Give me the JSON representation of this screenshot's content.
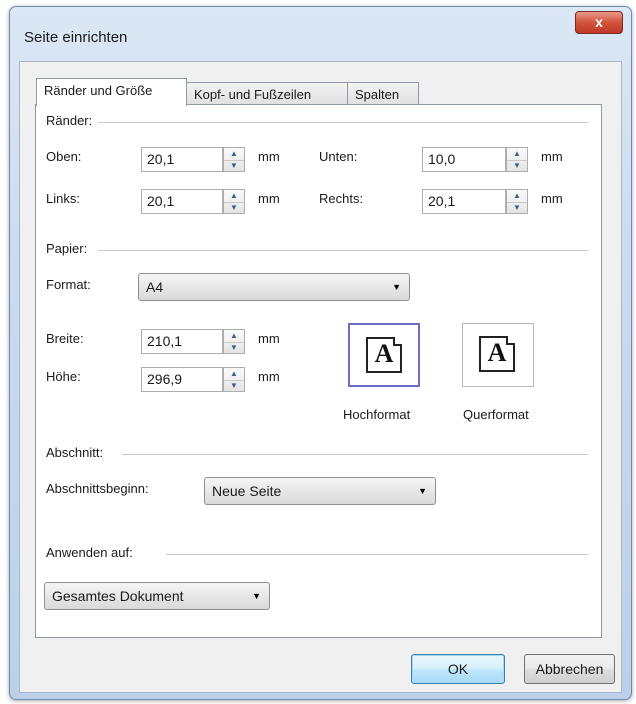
{
  "window": {
    "title": "Seite einrichten",
    "close_label": "x"
  },
  "tabs": [
    {
      "label": "Ränder und Größe",
      "active": true
    },
    {
      "label": "Kopf- und Fußzeilen",
      "active": false
    },
    {
      "label": "Spalten",
      "active": false
    }
  ],
  "margins": {
    "group_label": "Ränder:",
    "top": {
      "label": "Oben:",
      "value": "20,1",
      "unit": "mm"
    },
    "bottom": {
      "label": "Unten:",
      "value": "10,0",
      "unit": "mm"
    },
    "left": {
      "label": "Links:",
      "value": "20,1",
      "unit": "mm"
    },
    "right": {
      "label": "Rechts:",
      "value": "20,1",
      "unit": "mm"
    }
  },
  "paper": {
    "group_label": "Papier:",
    "format_label": "Format:",
    "format_value": "A4",
    "width": {
      "label": "Breite:",
      "value": "210,1",
      "unit": "mm"
    },
    "height": {
      "label": "Höhe:",
      "value": "296,9",
      "unit": "mm"
    },
    "orientation": {
      "portrait_label": "Hochformat",
      "landscape_label": "Querformat",
      "glyph": "A",
      "selected": "portrait"
    }
  },
  "section": {
    "group_label": "Abschnitt:",
    "start_label": "Abschnittsbeginn:",
    "start_value": "Neue Seite"
  },
  "apply": {
    "group_label": "Anwenden auf:",
    "value": "Gesamtes Dokument"
  },
  "buttons": {
    "ok": "OK",
    "cancel": "Abbrechen"
  },
  "colors": {
    "selection_border": "#6b6fc4",
    "close_button": "#c9442f",
    "title_bar": "#c9daef"
  }
}
